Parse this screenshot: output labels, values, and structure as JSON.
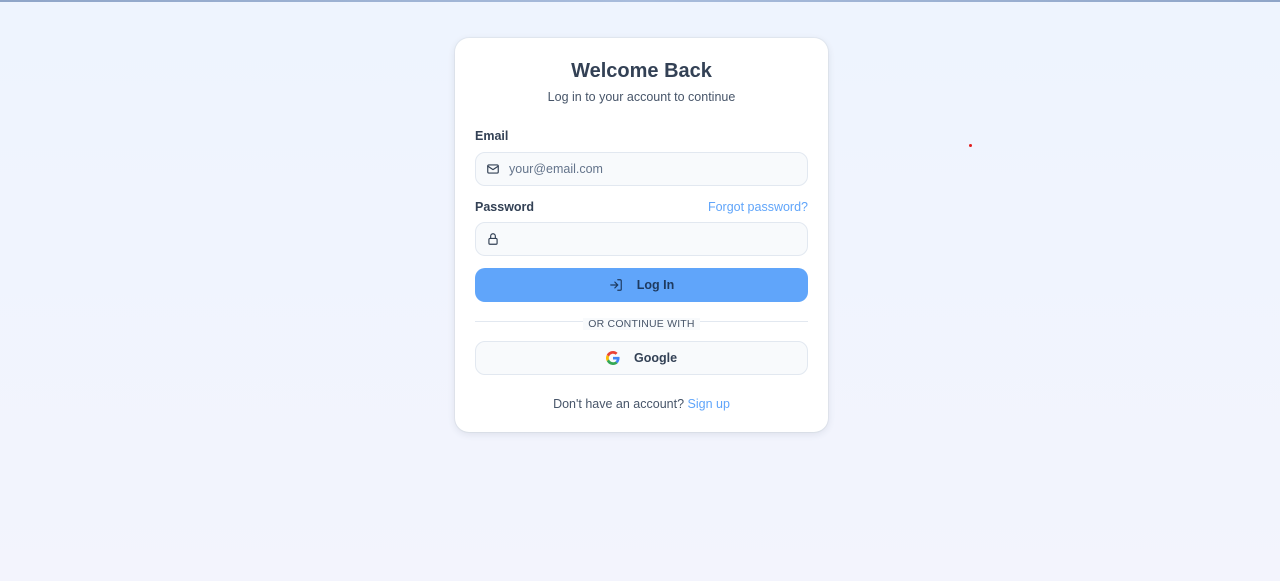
{
  "login": {
    "title": "Welcome Back",
    "subtitle": "Log in to your account to continue",
    "email_label": "Email",
    "email_placeholder": "your@email.com",
    "email_value": "",
    "password_label": "Password",
    "password_value": "",
    "forgot_link": "Forgot password?",
    "login_button": "Log In",
    "divider_text": "OR CONTINUE WITH",
    "google_button": "Google",
    "signup_prompt": "Don't have an account?",
    "signup_link": "Sign up"
  },
  "icons": {
    "email": "mail-icon",
    "password": "lock-icon",
    "login": "log-in-icon",
    "google": "google-icon"
  },
  "colors": {
    "accent": "#60a5fa",
    "heading": "#334155",
    "muted": "#475569",
    "background": "#eef4fe"
  }
}
